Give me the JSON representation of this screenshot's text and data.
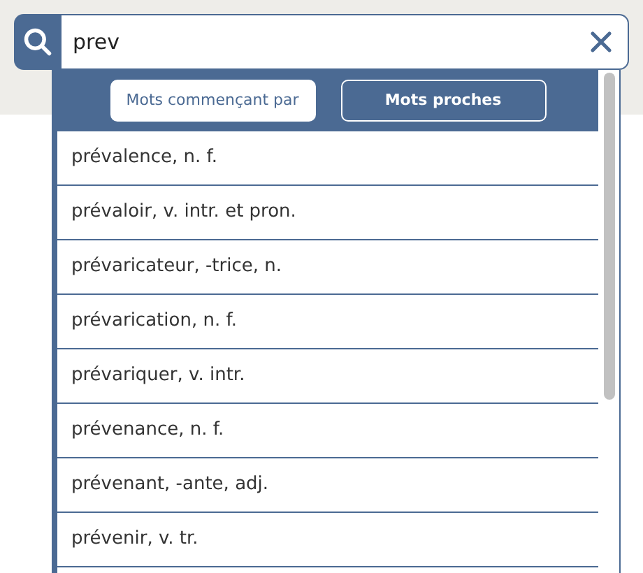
{
  "search": {
    "value": "prev"
  },
  "modes": [
    {
      "label": "Mots commençant par",
      "selected": true
    },
    {
      "label": "Mots proches",
      "selected": false
    }
  ],
  "results": [
    "prévalence, n. f.",
    "prévaloir, v. intr. et pron.",
    "prévaricateur, -trice, n.",
    "prévarication, n. f.",
    "prévariquer, v. intr.",
    "prévenance, n. f.",
    "prévenant, -ante, adj.",
    "prévenir, v. tr."
  ]
}
